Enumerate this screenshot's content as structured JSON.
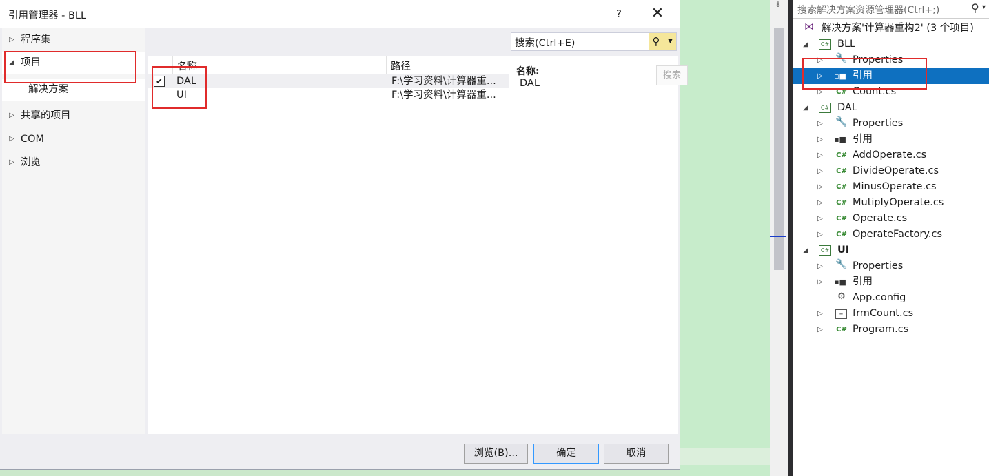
{
  "dialog": {
    "title": "引用管理器 - BLL",
    "help_label": "?",
    "close_label": "✕",
    "nav": [
      {
        "label": "程序集",
        "expanded": false
      },
      {
        "label": "项目",
        "expanded": true
      },
      {
        "label": "解决方案"
      },
      {
        "label": "共享的项目",
        "expanded": false
      },
      {
        "label": "COM",
        "expanded": false
      },
      {
        "label": "浏览",
        "expanded": false
      }
    ],
    "search": {
      "placeholder": "搜索(Ctrl+E)"
    },
    "columns": {
      "name": "名称",
      "path": "路径"
    },
    "rows": [
      {
        "checked": true,
        "name": "DAL",
        "path": "F:\\学习资料\\计算器重..."
      },
      {
        "checked": false,
        "name": "UI",
        "path": "F:\\学习资料\\计算器重..."
      }
    ],
    "detail": {
      "name_label": "名称:",
      "name_value": "DAL",
      "search_button": "搜索"
    },
    "buttons": {
      "browse": "浏览(B)...",
      "ok": "确定",
      "cancel": "取消"
    }
  },
  "solution_explorer": {
    "search_placeholder": "搜索解决方案资源管理器(Ctrl+;)",
    "solution_label": "解决方案'计算器重构2' (3 个项目)",
    "projects": [
      {
        "name": "BLL",
        "items": [
          {
            "label": "Properties",
            "icon": "wrench-icon"
          },
          {
            "label": "引用",
            "icon": "references-icon",
            "selected": true
          },
          {
            "label": "Count.cs",
            "icon": "csharp-file-icon"
          }
        ]
      },
      {
        "name": "DAL",
        "items": [
          {
            "label": "Properties",
            "icon": "wrench-icon"
          },
          {
            "label": "引用",
            "icon": "references-icon"
          },
          {
            "label": "AddOperate.cs",
            "icon": "csharp-file-icon"
          },
          {
            "label": "DivideOperate.cs",
            "icon": "csharp-file-icon"
          },
          {
            "label": "MinusOperate.cs",
            "icon": "csharp-file-icon"
          },
          {
            "label": "MutiplyOperate.cs",
            "icon": "csharp-file-icon"
          },
          {
            "label": "Operate.cs",
            "icon": "csharp-file-icon"
          },
          {
            "label": "OperateFactory.cs",
            "icon": "csharp-file-icon"
          }
        ]
      },
      {
        "name": "UI",
        "items": [
          {
            "label": "Properties",
            "icon": "wrench-icon"
          },
          {
            "label": "引用",
            "icon": "references-icon"
          },
          {
            "label": "App.config",
            "icon": "config-file-icon"
          },
          {
            "label": "frmCount.cs",
            "icon": "form-file-icon"
          },
          {
            "label": "Program.cs",
            "icon": "csharp-file-icon"
          }
        ]
      }
    ]
  },
  "colors": {
    "selection": "#0e70c0",
    "annotation": "#e02b2b",
    "accent": "#3399ff"
  }
}
